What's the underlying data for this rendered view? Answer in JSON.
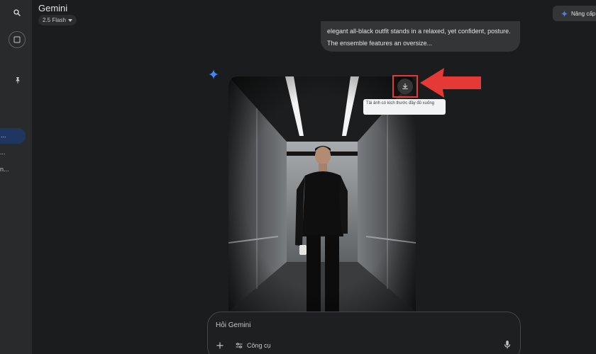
{
  "header": {
    "title": "Gemini",
    "model": "2.5 Flash",
    "upgrade_label": "Nâng cấp"
  },
  "sidebar": {
    "recent_items": [
      "...",
      "...",
      "n..."
    ]
  },
  "chat": {
    "user_message": "elegant all-black outfit stands in a relaxed, yet confident, posture. The ensemble features an oversize..."
  },
  "image_actions": {
    "download_tooltip": "Tải ảnh có kích thước đầy đủ xuống"
  },
  "prompt": {
    "placeholder": "Hỏi Gemini",
    "tools_label": "Công cụ"
  },
  "colors": {
    "background": "#1b1c1d",
    "sidebar": "#282a2c",
    "active_item": "#1f3760",
    "annotation": "#e53935",
    "spark": "#4285f4"
  },
  "icons": [
    "search-icon",
    "new-chat-icon",
    "pin-icon",
    "spark-icon",
    "download-icon",
    "plus-icon",
    "tools-icon",
    "mic-icon"
  ]
}
